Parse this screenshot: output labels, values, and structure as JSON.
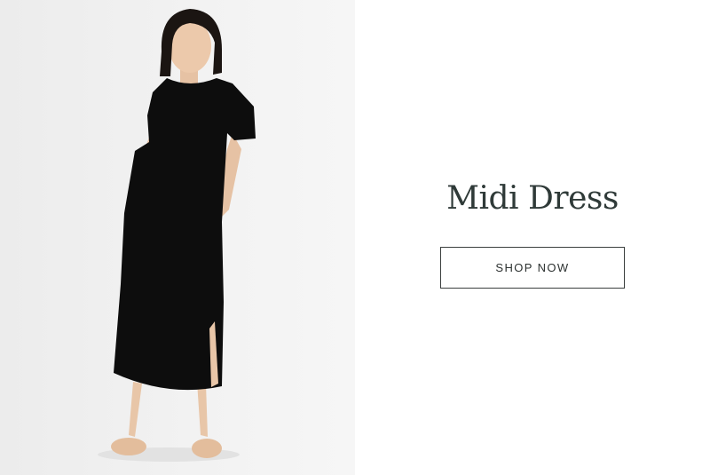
{
  "promo": {
    "title": "Midi Dress",
    "cta_label": "SHOP NOW",
    "image_subject": "model-in-black-midi-dress"
  },
  "colors": {
    "title_text": "#2f3a38",
    "button_border": "#3a3f3e",
    "photo_background": "#efefef",
    "dress": "#0d0d0d"
  }
}
